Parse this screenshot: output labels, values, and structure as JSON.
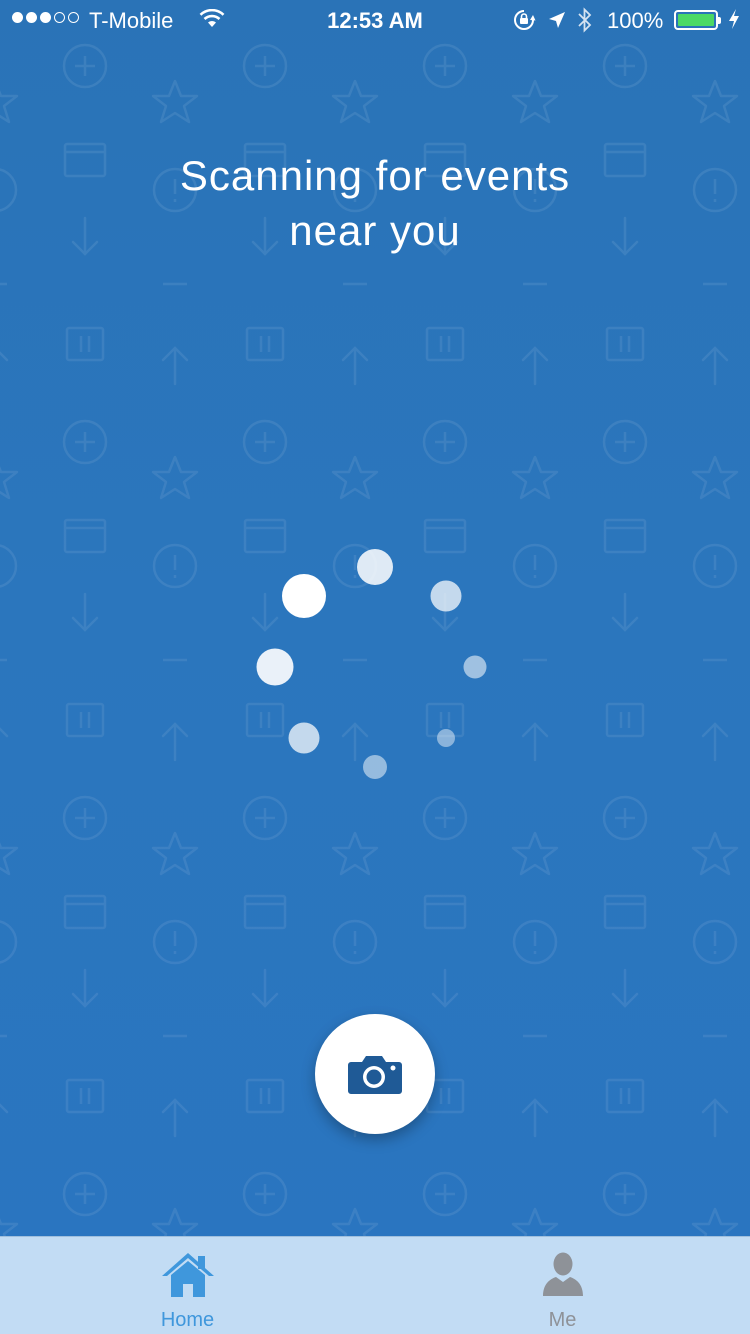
{
  "status_bar": {
    "carrier": "T-Mobile",
    "time": "12:53 AM",
    "battery_percent": "100%",
    "battery_level": 1.0,
    "signal_bars_filled": 3,
    "signal_bars_total": 5,
    "icons": [
      "wifi-icon",
      "rotation-lock-icon",
      "location-arrow-icon",
      "bluetooth-icon",
      "charging-bolt-icon"
    ]
  },
  "main": {
    "headline_line1": "Scanning for events",
    "headline_line2": "near you",
    "background_color": "#2b76bd",
    "background_pattern_icons": [
      "plus-circle-icon",
      "star-icon",
      "folder-icon",
      "alert-circle-icon",
      "arrow-down-icon",
      "minus-icon",
      "pause-icon",
      "arrow-up-icon"
    ]
  },
  "spinner": {
    "icon": "loading-spinner-icon",
    "dot_count": 8
  },
  "camera_button": {
    "icon": "camera-icon",
    "icon_color": "#1f5a96"
  },
  "tab_bar": {
    "background": "#c2dcf4",
    "active_color": "#3f97dc",
    "inactive_color": "#8e9298",
    "tabs": [
      {
        "label": "Home",
        "icon": "home-icon",
        "active": true
      },
      {
        "label": "Me",
        "icon": "person-icon",
        "active": false
      }
    ]
  }
}
